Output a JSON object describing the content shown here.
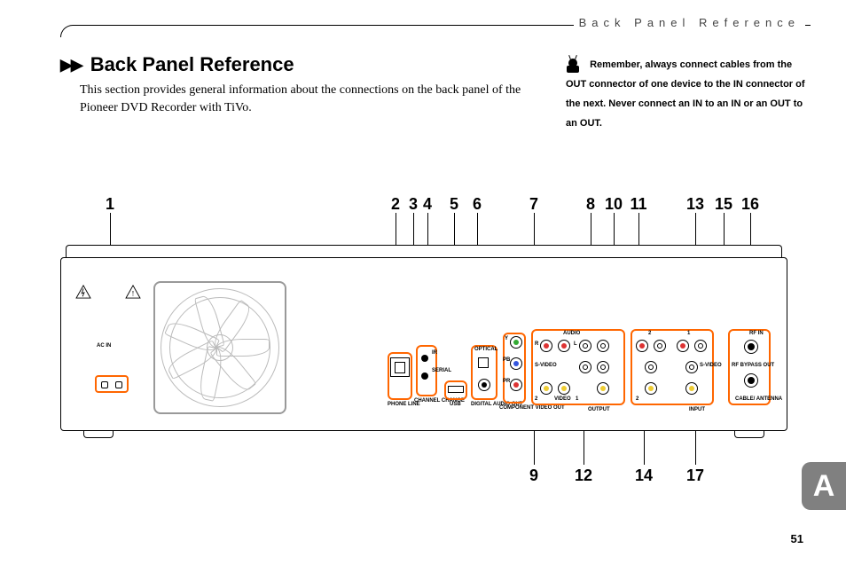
{
  "header": {
    "running_head": "Back Panel Reference"
  },
  "title": "Back Panel Reference",
  "intro": "This section provides general information about the connections on the back panel of the Pioneer DVD Recorder with TiVo.",
  "sidebar": {
    "text": "Remember, always connect cables from the OUT connector of one device to the IN connector of the next. Never connect an IN to an IN or an OUT to an OUT."
  },
  "callouts_top": [
    "1",
    "2",
    "3",
    "4",
    "5",
    "6",
    "7",
    "8",
    "10",
    "11",
    "13",
    "15",
    "16"
  ],
  "callouts_bottom": [
    "9",
    "12",
    "14",
    "17"
  ],
  "panel_labels": {
    "ac_in": "AC IN",
    "phone_line": "PHONE LINE",
    "channel_change": "CHANNEL CHANGE",
    "ir": "IR",
    "serial": "SERIAL",
    "usb": "USB",
    "digital_audio_out": "DIGITAL AUDIO OUT",
    "optical": "OPTICAL",
    "component_video_out": "COMPONENT VIDEO OUT",
    "y": "Y",
    "pb": "PB",
    "pr": "PR",
    "audio": "AUDIO",
    "r": "R",
    "l": "L",
    "video": "VIDEO",
    "svideo": "S-VIDEO",
    "output": "OUTPUT",
    "input": "INPUT",
    "one": "1",
    "two": "2",
    "rf_in": "RF IN",
    "rf_bypass_out": "RF BYPASS OUT",
    "cable_antenna": "CABLE/ ANTENNA"
  },
  "tab": "A",
  "page": "51"
}
